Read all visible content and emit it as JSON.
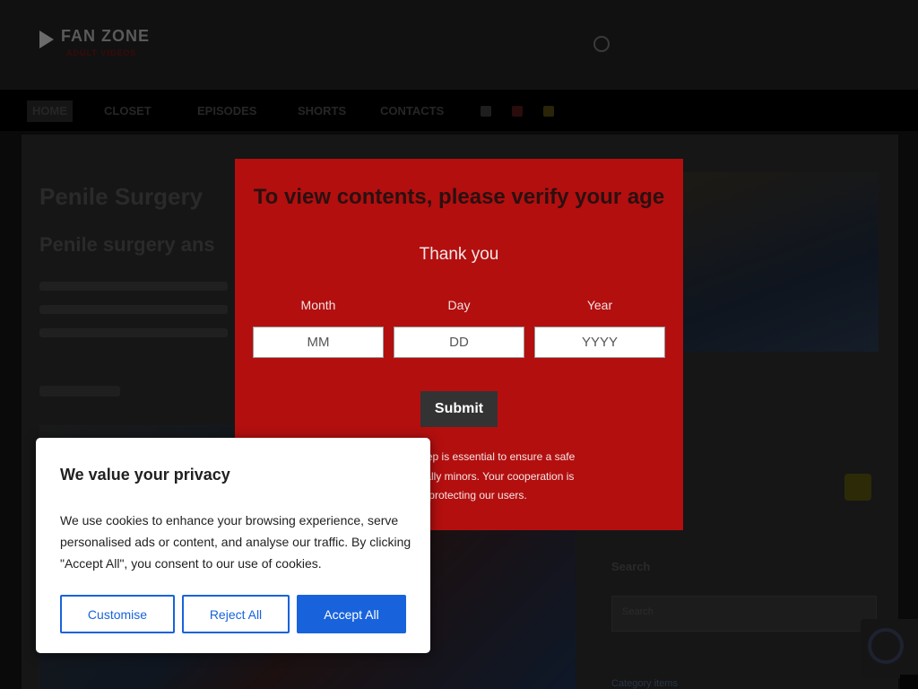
{
  "site": {
    "logo_text": "FAN ZONE",
    "logo_subtext": "ADULT VIDEOS",
    "nav": [
      "HOME",
      "CLOSET",
      "EPISODES",
      "SHORTS",
      "CONTACTS"
    ],
    "post_title": "Penile Surgery",
    "post_subtitle": "Penile surgery ans",
    "sidebar_heading": "Search",
    "sidebar_field_text": "Search",
    "sidebar_link": "Category items"
  },
  "age_gate": {
    "title": "To view contents, please verify your age",
    "thanks": "Thank you",
    "month_label": "Month",
    "day_label": "Day",
    "year_label": "Year",
    "month_placeholder": "MM",
    "day_placeholder": "DD",
    "year_placeholder": "YYYY",
    "submit_label": "Submit",
    "notice_line1": "erification! This step is essential to ensure a safe",
    "notice_line2": "everyone, especially minors. Your cooperation is",
    "notice_line3": "iated in protecting our users."
  },
  "cookie": {
    "title": "We value your privacy",
    "text": "We use cookies to enhance your browsing experience, serve personalised ads or content, and analyse our traffic. By clicking \"Accept All\", you consent to our use of cookies.",
    "customise_label": "Customise",
    "reject_label": "Reject All",
    "accept_label": "Accept All"
  },
  "colors": {
    "modal_red": "#b30f0f",
    "cookie_accent": "#1863dc"
  }
}
